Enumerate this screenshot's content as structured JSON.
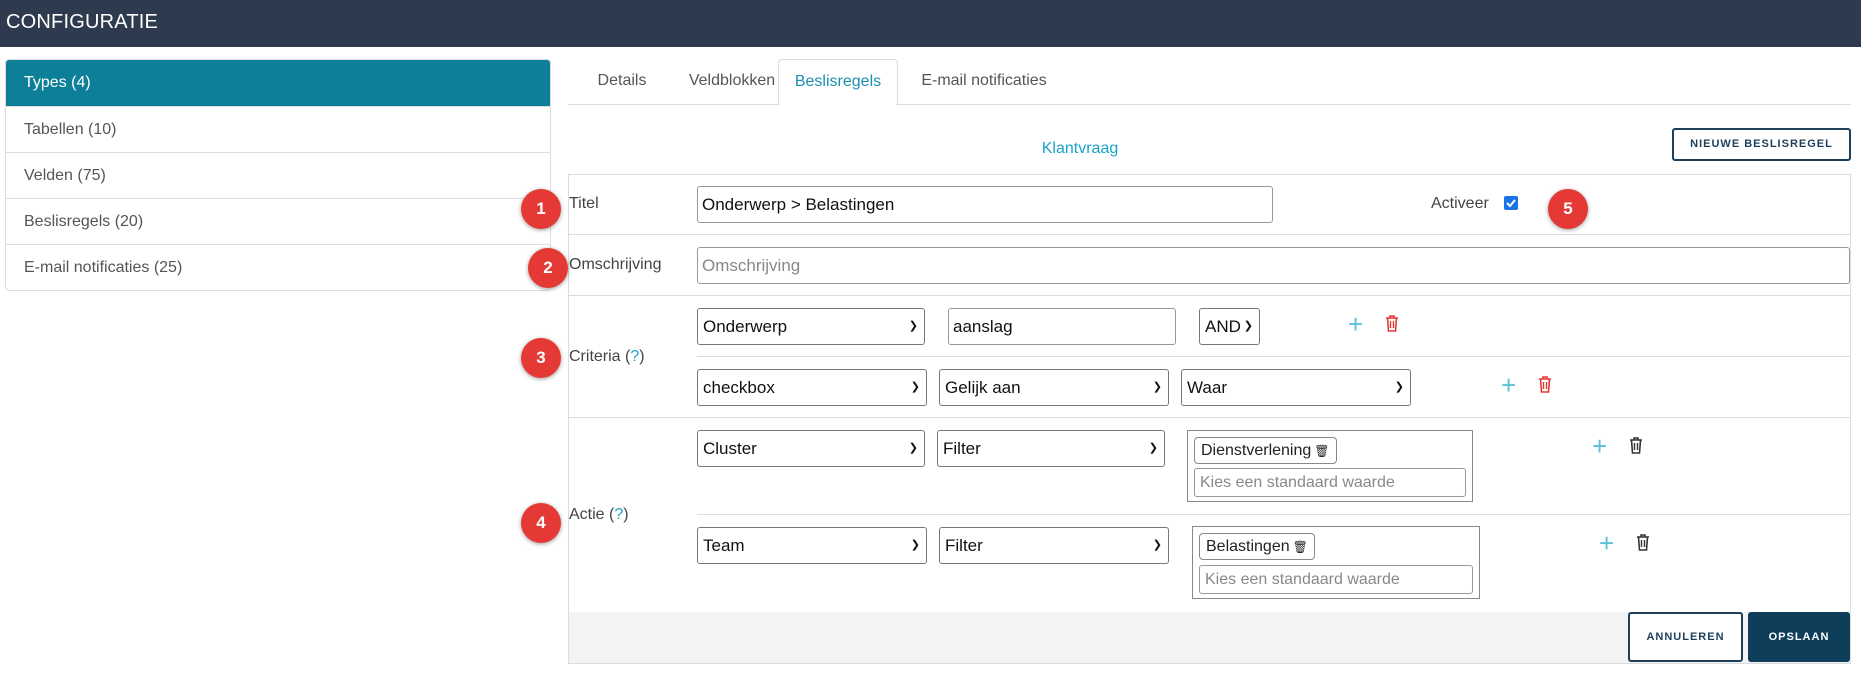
{
  "app_title": "CONFIGURATIE",
  "sidebar": {
    "items": [
      {
        "label": "Types (4)",
        "active": true
      },
      {
        "label": "Tabellen (10)"
      },
      {
        "label": "Velden (75)"
      },
      {
        "label": "Beslisregels (20)"
      },
      {
        "label": "E-mail notificaties (25)"
      }
    ]
  },
  "tabs": [
    {
      "label": "Details"
    },
    {
      "label": "Veldblokken"
    },
    {
      "label": "Beslisregels",
      "active": true
    },
    {
      "label": "E-mail notificaties"
    }
  ],
  "rule_group_title": "Klantvraag",
  "new_rule_button": "NIEUWE BESLISREGEL",
  "form": {
    "title_label": "Titel",
    "title_value": "Onderwerp > Belastingen",
    "activate_label": "Activeer",
    "activate_checked": true,
    "description_label": "Omschrijving",
    "description_placeholder": "Omschrijving",
    "criteria_label": "Criteria",
    "help_mark": "?",
    "criteria": [
      {
        "field": "Onderwerp",
        "value": "aanslag",
        "operator": "AND"
      },
      {
        "field": "checkbox",
        "comparator": "Gelijk aan",
        "value": "Waar"
      }
    ],
    "action_label": "Actie",
    "actions": [
      {
        "target": "Cluster",
        "type": "Filter",
        "chip": "Dienstverlening",
        "placeholder": "Kies een standaard waarde"
      },
      {
        "target": "Team",
        "type": "Filter",
        "chip": "Belastingen",
        "placeholder": "Kies een standaard waarde"
      }
    ]
  },
  "buttons": {
    "cancel": "ANNULEREN",
    "save": "OPSLAAN"
  },
  "badges": [
    "1",
    "2",
    "3",
    "4",
    "5"
  ],
  "colors": {
    "topbar": "#2e3b4e",
    "accent": "#0e7f99",
    "link": "#1aa3c8",
    "danger": "#e53935",
    "primary_button": "#0f3e5b"
  }
}
